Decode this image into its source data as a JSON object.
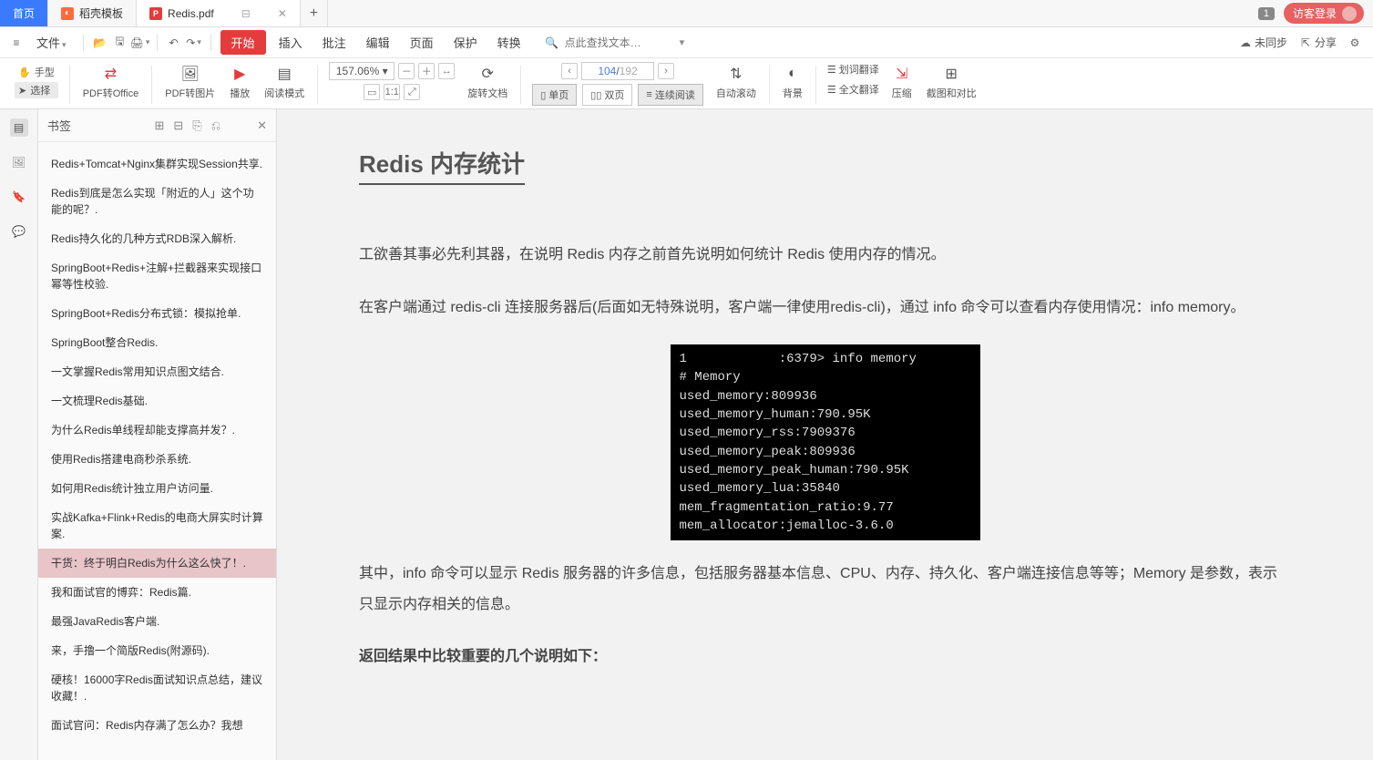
{
  "tabs": {
    "home": "首页",
    "template": "稻壳模板",
    "file": "Redis.pdf"
  },
  "topright": {
    "count": "1",
    "login": "访客登录"
  },
  "menubar": {
    "file": "文件",
    "items": [
      "开始",
      "插入",
      "批注",
      "编辑",
      "页面",
      "保护",
      "转换"
    ],
    "search_placeholder": "点此查找文本…",
    "unsync": "未同步",
    "share": "分享"
  },
  "toolbar": {
    "hand": "手型",
    "select": "选择",
    "pdf2office": "PDF转Office",
    "pdf2img": "PDF转图片",
    "play": "播放",
    "readmode": "阅读模式",
    "zoom": "157.06%",
    "rotate": "旋转文档",
    "single": "单页",
    "double": "双页",
    "continuous": "连续阅读",
    "page_cur": "104",
    "page_tot": "192",
    "autoscroll": "自动滚动",
    "background": "背景",
    "word_trans": "划词翻译",
    "full_trans": "全文翻译",
    "compress": "压缩",
    "crop": "截图和对比"
  },
  "bookmarks": {
    "title": "书签",
    "items": [
      "Redis+Tomcat+Nginx集群实现Session共享.",
      "Redis到底是怎么实现「附近的人」这个功能的呢？.",
      "Redis持久化的几种方式RDB深入解析.",
      "SpringBoot+Redis+注解+拦截器来实现接口幂等性校验.",
      "SpringBoot+Redis分布式锁：模拟抢单.",
      "SpringBoot整合Redis.",
      "一文掌握Redis常用知识点图文结合.",
      "一文梳理Redis基础.",
      "为什么Redis单线程却能支撑高并发？.",
      "使用Redis搭建电商秒杀系统.",
      "如何用Redis统计独立用户访问量.",
      "实战Kafka+Flink+Redis的电商大屏实时计算案.",
      "干货：终于明白Redis为什么这么快了！.",
      "我和面试官的博弈：Redis篇.",
      "最强JavaRedis客户端.",
      "来，手撸一个简版Redis(附源码).",
      "硬核！16000字Redis面试知识点总结，建议收藏！.",
      "面试官问：Redis内存满了怎么办？我想"
    ],
    "active_index": 12
  },
  "document": {
    "heading": "Redis 内存统计",
    "para1": "工欲善其事必先利其器，在说明 Redis 内存之前首先说明如何统计 Redis 使用内存的情况。",
    "para2": "在客户端通过 redis-cli 连接服务器后(后面如无特殊说明，客户端一律使用redis-cli)，通过 info 命令可以查看内存使用情况：info memory。",
    "terminal": {
      "prompt": "1            :6379> info memory",
      "lines": [
        "# Memory",
        "used_memory:809936",
        "used_memory_human:790.95K",
        "used_memory_rss:7909376",
        "used_memory_peak:809936",
        "used_memory_peak_human:790.95K",
        "used_memory_lua:35840",
        "mem_fragmentation_ratio:9.77",
        "mem_allocator:jemalloc-3.6.0"
      ]
    },
    "para3": "其中，info  命令可以显示  Redis  服务器的许多信息，包括服务器基本信息、CPU、内存、持久化、客户端连接信息等等；Memory 是参数，表示只显示内存相关的信息。",
    "para4": "返回结果中比较重要的几个说明如下："
  }
}
